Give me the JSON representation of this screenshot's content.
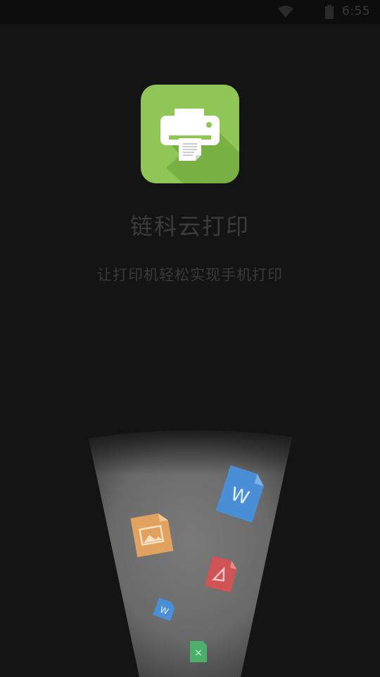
{
  "status_bar": {
    "time": "6:55",
    "icons": [
      "wifi-icon",
      "battery-icon"
    ]
  },
  "app": {
    "icon": "printer-icon",
    "title": "链科云打印",
    "tagline": "让打印机轻松实现手机打印",
    "colors": {
      "background": "#141414",
      "icon_bg": "#8fc655",
      "icon_shadow": "#6fa23f",
      "text": "#3c3c3c"
    }
  },
  "illustration": {
    "files": [
      {
        "type": "word",
        "icon": "word-file-icon",
        "glyph": "W",
        "color": "#4a8fd6"
      },
      {
        "type": "image",
        "icon": "image-file-icon",
        "color": "#e8a25a"
      },
      {
        "type": "pdf",
        "icon": "pdf-file-icon",
        "color": "#d9534f"
      },
      {
        "type": "word",
        "icon": "word-file-icon-small",
        "glyph": "W",
        "color": "#4a8fd6"
      },
      {
        "type": "excel",
        "icon": "excel-file-icon",
        "glyph": "×",
        "color": "#4caf6a"
      }
    ]
  }
}
